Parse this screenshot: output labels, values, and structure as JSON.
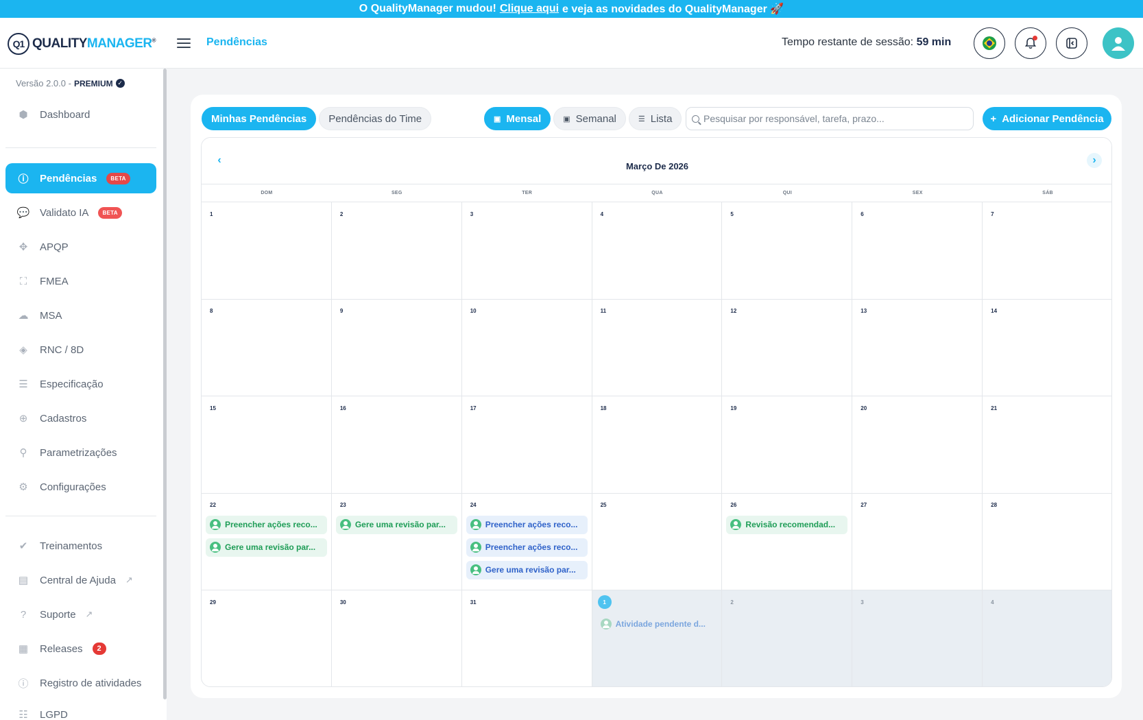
{
  "announcement": {
    "before": "O QualityManager mudou!",
    "link": "Clique aqui",
    "after": "e veja as novidades do QualityManager 🚀"
  },
  "header": {
    "logo_q": "QUALITY",
    "logo_m": "MANAGER",
    "logo_mark": "Q1",
    "breadcrumb": "Pendências",
    "session_label": "Tempo restante de sessão:",
    "session_value": "59 min",
    "icons": [
      "brazil-flag-icon",
      "bell-icon",
      "collapse-panel-icon",
      "user-avatar-icon"
    ]
  },
  "sidebar": {
    "version": "Versão 2.0.0 -",
    "plan": "PREMIUM",
    "items": [
      {
        "label": "Dashboard",
        "icon": "dashboard-icon"
      },
      {
        "label": "Pendências",
        "icon": "alert-icon",
        "badge": "BETA",
        "active": true
      },
      {
        "label": "Validato IA",
        "icon": "chat-icon",
        "badge": "BETA"
      },
      {
        "label": "APQP",
        "icon": "apqp-icon"
      },
      {
        "label": "FMEA",
        "icon": "fmea-icon"
      },
      {
        "label": "MSA",
        "icon": "msa-icon"
      },
      {
        "label": "RNC / 8D",
        "icon": "layers-icon"
      },
      {
        "label": "Especificação",
        "icon": "spec-icon"
      },
      {
        "label": "Cadastros",
        "icon": "plus-icon"
      },
      {
        "label": "Parametrizações",
        "icon": "sliders-icon"
      },
      {
        "label": "Configurações",
        "icon": "gear-icon"
      },
      {
        "label": "Treinamentos",
        "icon": "check-icon"
      },
      {
        "label": "Central de Ajuda",
        "icon": "help-book-icon"
      },
      {
        "label": "Suporte",
        "icon": "support-icon"
      },
      {
        "label": "Releases",
        "icon": "releases-icon",
        "count": "2"
      },
      {
        "label": "Registro de atividades",
        "icon": "info-icon"
      },
      {
        "label": "LGPD",
        "icon": "list-icon"
      }
    ]
  },
  "toolbar": {
    "tab_mine": "Minhas Pendências",
    "tab_team": "Pendências do Time",
    "view_month": "Mensal",
    "view_week": "Semanal",
    "view_list": "Lista",
    "search_placeholder": "Pesquisar por responsável, tarefa, prazo...",
    "add_label": "Adicionar Pendência"
  },
  "calendar": {
    "title": "Março De 2026",
    "weekdays": [
      "DOM",
      "SEG",
      "TER",
      "QUA",
      "QUI",
      "SEX",
      "SÁB"
    ],
    "days": [
      {
        "n": "1"
      },
      {
        "n": "2"
      },
      {
        "n": "3"
      },
      {
        "n": "4"
      },
      {
        "n": "5"
      },
      {
        "n": "6"
      },
      {
        "n": "7"
      },
      {
        "n": "8"
      },
      {
        "n": "9"
      },
      {
        "n": "10"
      },
      {
        "n": "11"
      },
      {
        "n": "12"
      },
      {
        "n": "13"
      },
      {
        "n": "14"
      },
      {
        "n": "15"
      },
      {
        "n": "16"
      },
      {
        "n": "17"
      },
      {
        "n": "18"
      },
      {
        "n": "19"
      },
      {
        "n": "20"
      },
      {
        "n": "21"
      },
      {
        "n": "22",
        "events": [
          {
            "text": "Preencher ações reco...",
            "color": "green"
          },
          {
            "text": "Gere uma revisão par...",
            "color": "green"
          }
        ]
      },
      {
        "n": "23",
        "events": [
          {
            "text": "Gere uma revisão par...",
            "color": "green"
          }
        ]
      },
      {
        "n": "24",
        "events": [
          {
            "text": "Preencher ações reco...",
            "color": "blue"
          },
          {
            "text": "Preencher ações reco...",
            "color": "blue"
          },
          {
            "text": "Gere uma revisão par...",
            "color": "blue"
          }
        ]
      },
      {
        "n": "25"
      },
      {
        "n": "26",
        "events": [
          {
            "text": "Revisão recomendad...",
            "color": "green"
          }
        ]
      },
      {
        "n": "27"
      },
      {
        "n": "28"
      },
      {
        "n": "29"
      },
      {
        "n": "30"
      },
      {
        "n": "31"
      },
      {
        "n": "1",
        "muted": true,
        "today": true,
        "events": [
          {
            "text": "Atividade pendente d...",
            "color": "faded"
          }
        ]
      },
      {
        "n": "2",
        "muted": true
      },
      {
        "n": "3",
        "muted": true
      },
      {
        "n": "4",
        "muted": true
      }
    ]
  },
  "colors": {
    "accent": "#1bb5f0",
    "navy": "#1c2b4a",
    "badge_red": "#f05454",
    "event_green": "#1f9d57",
    "event_blue": "#2f62c9"
  }
}
